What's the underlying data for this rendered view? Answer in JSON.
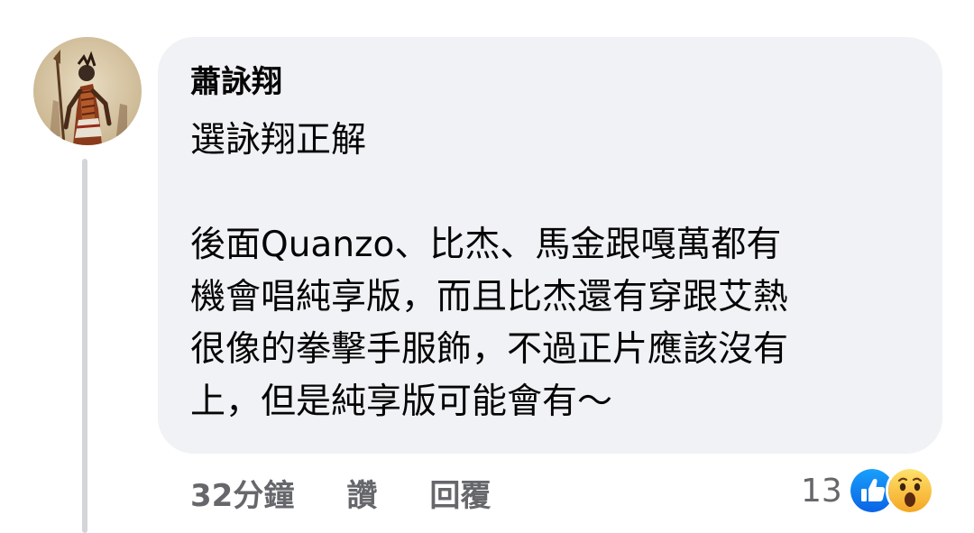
{
  "comment": {
    "author": "蕭詠翔",
    "text_lines": [
      "選詠翔正解",
      "",
      "後面Quanzo、比杰、馬金跟嘎萬都有",
      "機會唱純享版，而且比杰還有穿跟艾熱",
      "很像的拳擊手服飾，不過正片應該沒有",
      "上，但是純享版可能會有～"
    ]
  },
  "actions": {
    "time": "32分鐘",
    "like": "讚",
    "reply": "回覆"
  },
  "reactions": {
    "count": "13",
    "icons": [
      "like-icon",
      "wow-icon"
    ]
  },
  "colors": {
    "bubble": "#f0f2f5",
    "meta_text": "#65676b",
    "like_blue": "#1877f2",
    "wow_yellow": "#f7b125"
  }
}
